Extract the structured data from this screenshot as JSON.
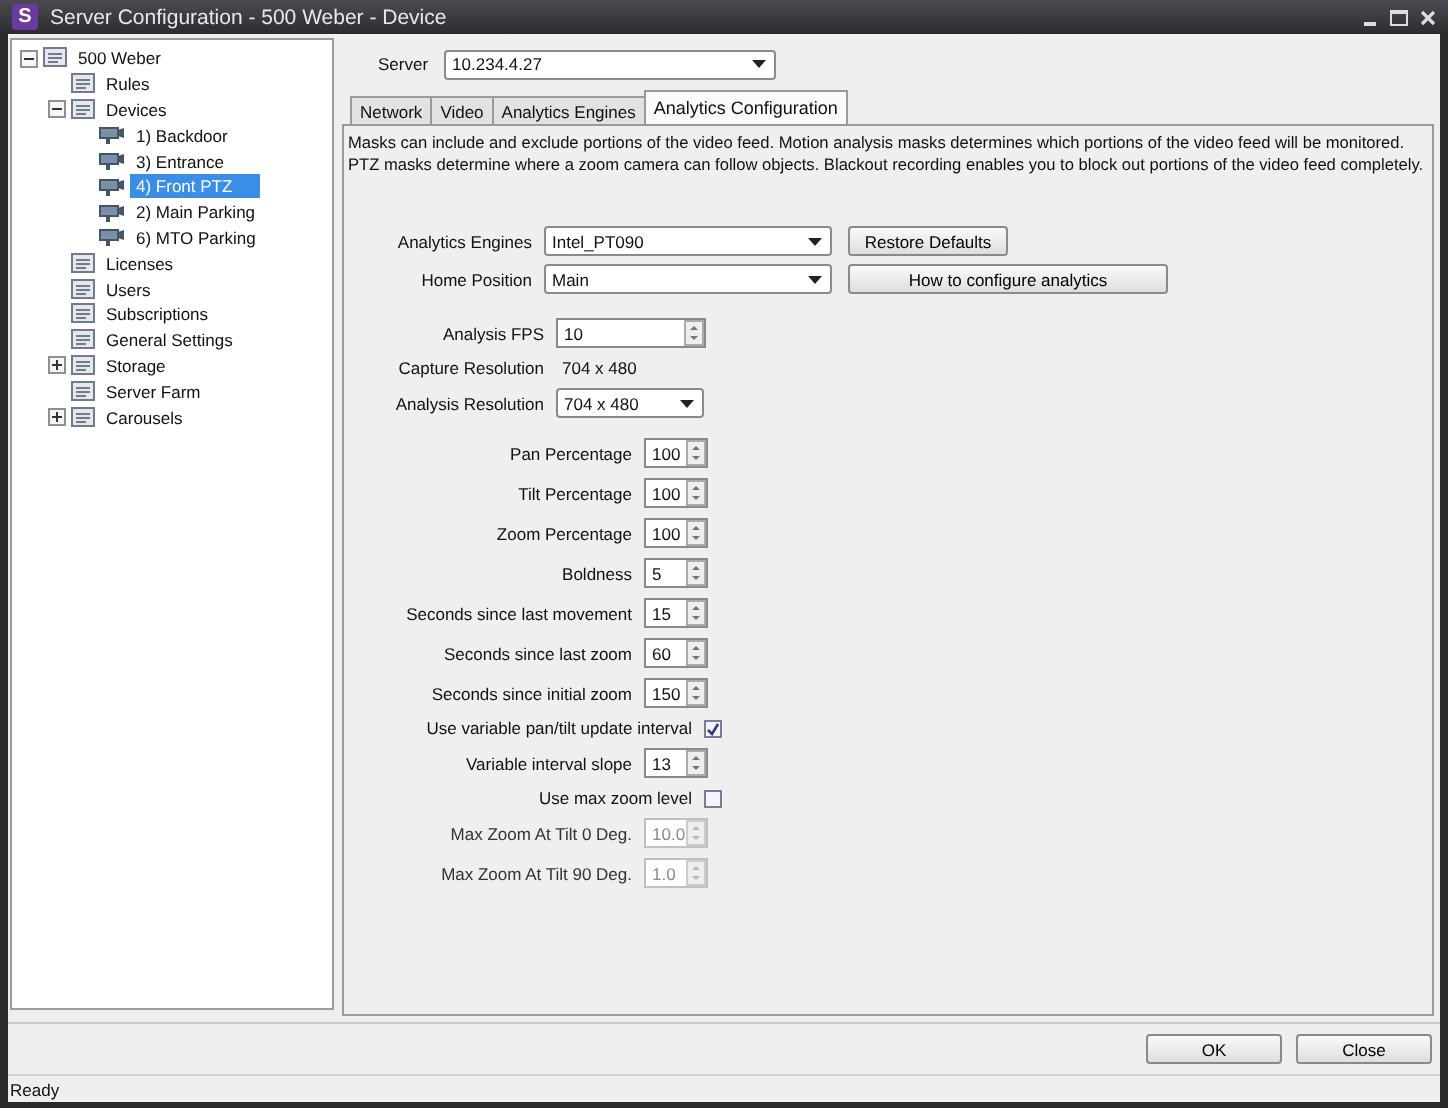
{
  "window": {
    "title": "Server Configuration - 500 Weber - Device",
    "app_letter": "S"
  },
  "tree": [
    {
      "label": "500 Weber",
      "expanded": true,
      "selected": false,
      "children": [
        {
          "label": "Rules",
          "selected": false
        },
        {
          "label": "Devices",
          "expanded": true,
          "selected": false,
          "children": [
            {
              "label": "1) Backdoor",
              "selected": false
            },
            {
              "label": "3) Entrance",
              "selected": false
            },
            {
              "label": "4) Front PTZ",
              "selected": true
            },
            {
              "label": "2) Main Parking",
              "selected": false
            },
            {
              "label": "6) MTO Parking",
              "selected": false
            }
          ]
        },
        {
          "label": "Licenses",
          "selected": false
        },
        {
          "label": "Users",
          "selected": false
        },
        {
          "label": "Subscriptions",
          "selected": false
        },
        {
          "label": "General Settings",
          "selected": false
        },
        {
          "label": "Storage",
          "expanded": false,
          "selected": false
        },
        {
          "label": "Server Farm",
          "selected": false
        },
        {
          "label": "Carousels",
          "expanded": false,
          "selected": false
        }
      ]
    }
  ],
  "server": {
    "label": "Server",
    "value": "10.234.4.27"
  },
  "tabs": [
    {
      "label": "Network",
      "selected": false
    },
    {
      "label": "Video",
      "selected": false
    },
    {
      "label": "Analytics Engines",
      "selected": false
    },
    {
      "label": "Analytics Configuration",
      "selected": true
    }
  ],
  "description": "Masks can include and exclude portions of the video feed.  Motion analysis masks determines which portions of the video feed will be monitored.  PTZ masks determine where a zoom camera can follow objects.  Blackout recording enables you to block out portions of the video feed completely.",
  "top_fields": [
    {
      "label": "Analytics Engines",
      "value": "Intel_PT090",
      "button": "Restore Defaults"
    },
    {
      "label": "Home Position",
      "value": "Main",
      "button": "How to configure analytics"
    }
  ],
  "video_fields": [
    {
      "kind": "spin",
      "label": "Analysis FPS",
      "value": "10"
    },
    {
      "kind": "text",
      "label": "Capture Resolution",
      "value": "704 x 480"
    },
    {
      "kind": "combo",
      "label": "Analysis Resolution",
      "value": "704 x 480"
    }
  ],
  "ptz_fields": [
    {
      "kind": "spin",
      "label": "Pan Percentage",
      "value": "100",
      "disabled": false
    },
    {
      "kind": "spin",
      "label": "Tilt Percentage",
      "value": "100",
      "disabled": false
    },
    {
      "kind": "spin",
      "label": "Zoom Percentage",
      "value": "100",
      "disabled": false
    },
    {
      "kind": "spin",
      "label": "Boldness",
      "value": "5",
      "disabled": false
    },
    {
      "kind": "spin",
      "label": "Seconds since last movement",
      "value": "15",
      "disabled": false
    },
    {
      "kind": "spin",
      "label": "Seconds since last zoom",
      "value": "60",
      "disabled": false
    },
    {
      "kind": "spin",
      "label": "Seconds since initial zoom",
      "value": "150",
      "disabled": false
    },
    {
      "kind": "check",
      "label": "Use variable pan/tilt update interval",
      "checked": true
    },
    {
      "kind": "spin",
      "label": "Variable interval slope",
      "value": "13",
      "disabled": false
    },
    {
      "kind": "check",
      "label": "Use max zoom level",
      "checked": false
    },
    {
      "kind": "spin",
      "label": "Max Zoom At Tilt 0 Deg.",
      "value": "10.0",
      "disabled": true
    },
    {
      "kind": "spin",
      "label": "Max Zoom At Tilt 90 Deg.",
      "value": "1.0",
      "disabled": true
    }
  ],
  "buttons": [
    "OK",
    "Close"
  ],
  "status_bar": "Ready"
}
